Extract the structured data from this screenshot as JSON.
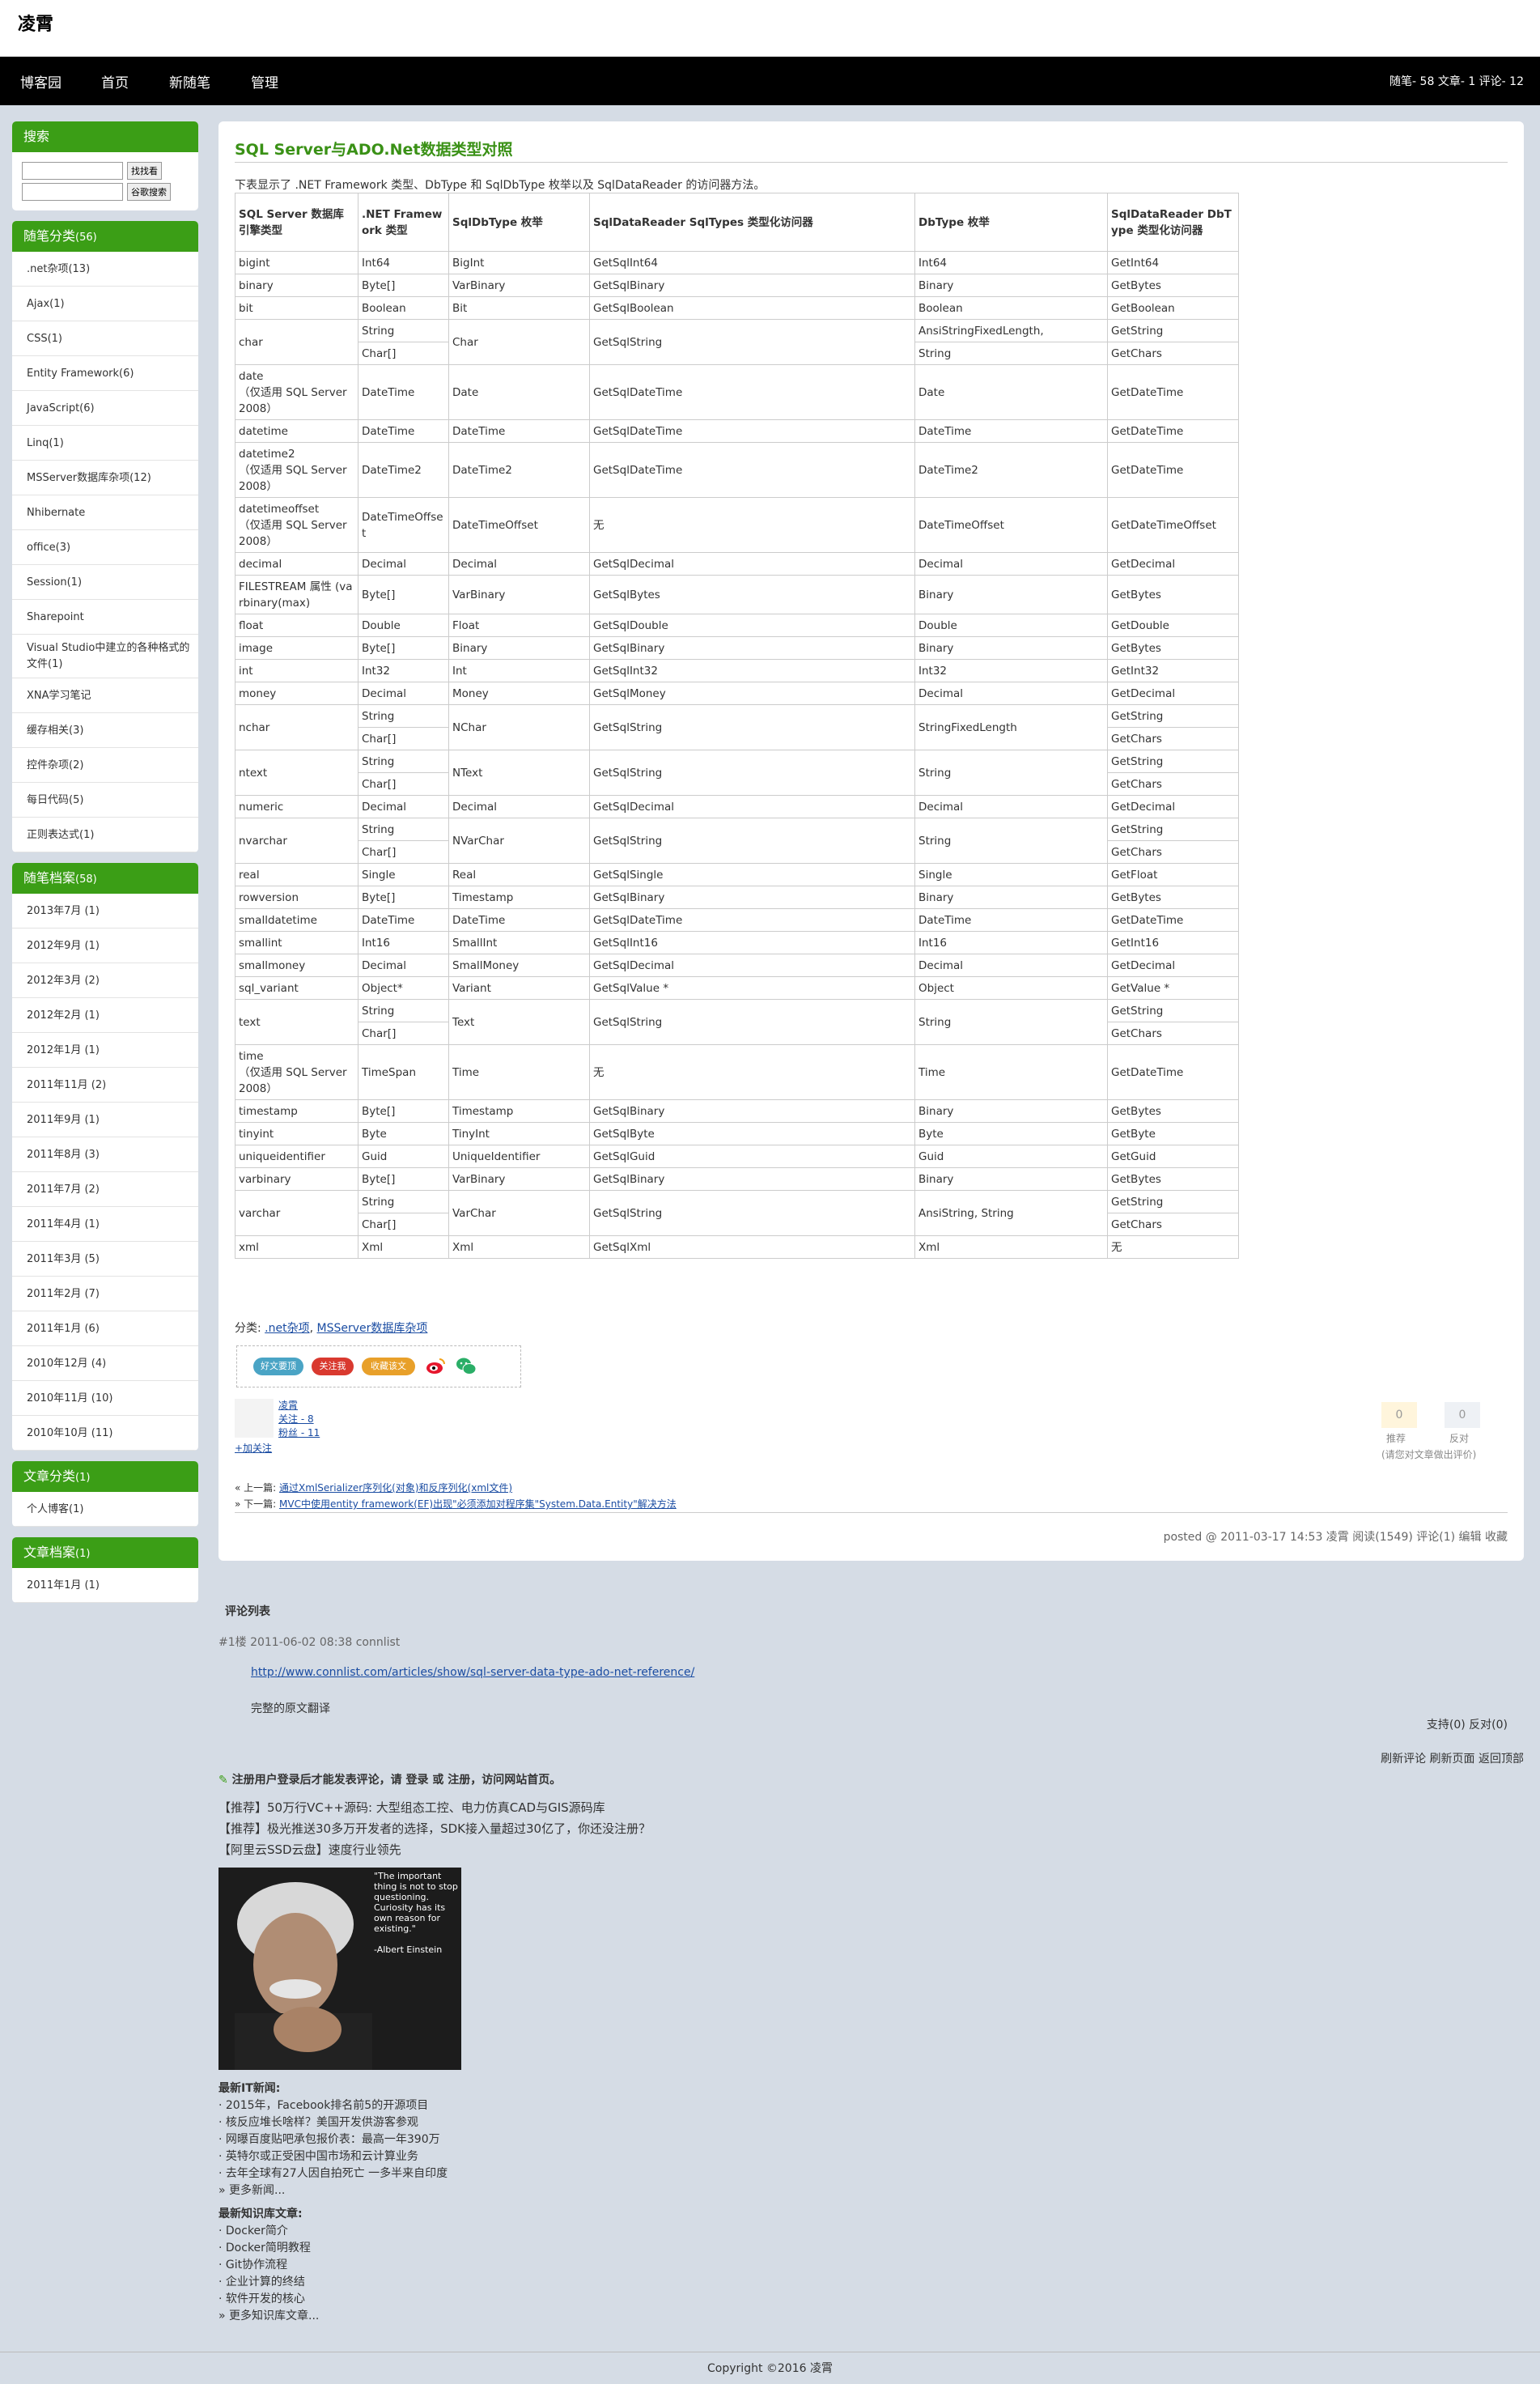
{
  "blog": {
    "title": "凌霄"
  },
  "nav": {
    "items": [
      "博客园",
      "首页",
      "新随笔",
      "管理"
    ],
    "stats": "随笔- 58  文章- 1  评论- 12"
  },
  "sidebar": {
    "search": {
      "title": "搜索",
      "btn1": "找找看",
      "btn2": "谷歌搜索"
    },
    "categories": {
      "title": "随笔分类",
      "count": "(56)",
      "items": [
        ".net杂项(13)",
        "Ajax(1)",
        "CSS(1)",
        "Entity Framework(6)",
        "JavaScript(6)",
        "Linq(1)",
        "MSServer数据库杂项(12)",
        "Nhibernate",
        "office(3)",
        "Session(1)",
        "Sharepoint",
        "Visual Studio中建立的各种格式的文件(1)",
        "XNA学习笔记",
        "缓存相关(3)",
        "控件杂项(2)",
        "每日代码(5)",
        "正则表达式(1)"
      ]
    },
    "archives": {
      "title": "随笔档案",
      "count": "(58)",
      "items": [
        "2013年7月 (1)",
        "2012年9月 (1)",
        "2012年3月 (2)",
        "2012年2月 (1)",
        "2012年1月 (1)",
        "2011年11月 (2)",
        "2011年9月 (1)",
        "2011年8月 (3)",
        "2011年7月 (2)",
        "2011年4月 (1)",
        "2011年3月 (5)",
        "2011年2月 (7)",
        "2011年1月 (6)",
        "2010年12月 (4)",
        "2010年11月 (10)",
        "2010年10月 (11)"
      ]
    },
    "article_cat": {
      "title": "文章分类",
      "count": "(1)",
      "items": [
        "个人博客(1)"
      ]
    },
    "article_arch": {
      "title": "文章档案",
      "count": "(1)",
      "items": [
        "2011年1月 (1)"
      ]
    }
  },
  "post": {
    "title": "SQL Server与ADO.Net数据类型对照",
    "intro": "下表显示了 .NET Framework 类型、DbType 和 SqlDbType 枚举以及 SqlDataReader 的访问器方法。",
    "headers": [
      "SQL Server 数据库引擎类型",
      ".NET Framework 类型",
      "SqlDbType 枚举",
      "SqlDataReader SqlTypes 类型化访问器",
      "DbType 枚举",
      "SqlDataReader DbType 类型化访问器"
    ],
    "rows": [
      [
        "bigint",
        "Int64",
        "BigInt",
        "GetSqlInt64",
        "Int64",
        "GetInt64"
      ],
      [
        "binary",
        "Byte[]",
        "VarBinary",
        "GetSqlBinary",
        "Binary",
        "GetBytes"
      ],
      [
        "bit",
        "Boolean",
        "Bit",
        "GetSqlBoolean",
        "Boolean",
        "GetBoolean"
      ],
      [
        "char",
        "String|Char[]",
        "Char",
        "GetSqlString",
        "AnsiStringFixedLength,|String",
        "GetString|GetChars"
      ],
      [
        "date\n（仅适用 SQL Server 2008）",
        "DateTime",
        "Date",
        "GetSqlDateTime",
        "Date",
        "GetDateTime"
      ],
      [
        "datetime",
        "DateTime",
        "DateTime",
        "GetSqlDateTime",
        "DateTime",
        "GetDateTime"
      ],
      [
        "datetime2\n（仅适用 SQL Server 2008）",
        "DateTime2",
        "DateTime2",
        "GetSqlDateTime",
        "DateTime2",
        "GetDateTime"
      ],
      [
        "datetimeoffset\n（仅适用 SQL Server 2008）",
        "DateTimeOffset",
        "DateTimeOffset",
        "无",
        "DateTimeOffset",
        "GetDateTimeOffset"
      ],
      [
        "decimal",
        "Decimal",
        "Decimal",
        "GetSqlDecimal",
        "Decimal",
        "GetDecimal"
      ],
      [
        "FILESTREAM 属性 (varbinary(max)",
        "Byte[]",
        "VarBinary",
        "GetSqlBytes",
        "Binary",
        "GetBytes"
      ],
      [
        "float",
        "Double",
        "Float",
        "GetSqlDouble",
        "Double",
        "GetDouble"
      ],
      [
        "image",
        "Byte[]",
        "Binary",
        "GetSqlBinary",
        "Binary",
        "GetBytes"
      ],
      [
        "int",
        "Int32",
        "Int",
        "GetSqlInt32",
        "Int32",
        "GetInt32"
      ],
      [
        "money",
        "Decimal",
        "Money",
        "GetSqlMoney",
        "Decimal",
        "GetDecimal"
      ],
      [
        "nchar",
        "String|Char[]",
        "NChar",
        "GetSqlString",
        "StringFixedLength",
        "GetString|GetChars"
      ],
      [
        "ntext",
        "String|Char[]",
        "NText",
        "GetSqlString",
        "String",
        "GetString|GetChars"
      ],
      [
        "numeric",
        "Decimal",
        "Decimal",
        "GetSqlDecimal",
        "Decimal",
        "GetDecimal"
      ],
      [
        "nvarchar",
        "String|Char[]",
        "NVarChar",
        "GetSqlString",
        "String",
        "GetString|GetChars"
      ],
      [
        "real",
        "Single",
        "Real",
        "GetSqlSingle",
        "Single",
        "GetFloat"
      ],
      [
        "rowversion",
        "Byte[]",
        "Timestamp",
        "GetSqlBinary",
        "Binary",
        "GetBytes"
      ],
      [
        "smalldatetime",
        "DateTime",
        "DateTime",
        "GetSqlDateTime",
        "DateTime",
        "GetDateTime"
      ],
      [
        "smallint",
        "Int16",
        "SmallInt",
        "GetSqlInt16",
        "Int16",
        "GetInt16"
      ],
      [
        "smallmoney",
        "Decimal",
        "SmallMoney",
        "GetSqlDecimal",
        "Decimal",
        "GetDecimal"
      ],
      [
        "sql_variant",
        "Object*",
        "Variant",
        "GetSqlValue *",
        "Object",
        "GetValue *"
      ],
      [
        "text",
        "String|Char[]",
        "Text",
        "GetSqlString",
        "String",
        "GetString|GetChars"
      ],
      [
        "time\n（仅适用 SQL Server 2008）",
        "TimeSpan",
        "Time",
        "无",
        "Time",
        "GetDateTime"
      ],
      [
        "timestamp",
        "Byte[]",
        "Timestamp",
        "GetSqlBinary",
        "Binary",
        "GetBytes"
      ],
      [
        "tinyint",
        "Byte",
        "TinyInt",
        "GetSqlByte",
        "Byte",
        "GetByte"
      ],
      [
        "uniqueidentifier",
        "Guid",
        "UniqueIdentifier",
        "GetSqlGuid",
        "Guid",
        "GetGuid"
      ],
      [
        "varbinary",
        "Byte[]",
        "VarBinary",
        "GetSqlBinary",
        "Binary",
        "GetBytes"
      ],
      [
        "varchar",
        "String|Char[]",
        "VarChar",
        "GetSqlString",
        "AnsiString, String",
        "GetString|GetChars"
      ],
      [
        "xml",
        "Xml",
        "Xml",
        "GetSqlXml",
        "Xml",
        "无"
      ]
    ],
    "category_label": "分类:",
    "categories": [
      ".net杂项",
      "MSServer数据库杂项"
    ],
    "share": {
      "btn1": "好文要顶",
      "btn2": "关注我",
      "btn3": "收藏该文"
    },
    "author": {
      "name": "凌霄",
      "follow": "关注 - 8",
      "fans": "粉丝 - 11",
      "add": "+加关注"
    },
    "vote": {
      "up": "0",
      "down": "0",
      "up_label": "推荐",
      "down_label": "反对",
      "tip": "(请您对文章做出评价)"
    },
    "prev": {
      "label": "« 上一篇:",
      "text": "通过XmlSerializer序列化(对象)和反序列化(xml文件)"
    },
    "next": {
      "label": "» 下一篇:",
      "text": "MVC中使用entity framework(EF)出现\"必须添加对程序集\"System.Data.Entity\"解决方法"
    },
    "footer": "posted @ 2011-03-17 14:53 凌霄 阅读(1549) 评论(1) 编辑 收藏"
  },
  "comments": {
    "title": "评论列表",
    "meta": "#1楼 2011-06-02 08:38 connlist",
    "link": "http://www.connlist.com/articles/show/sql-server-data-type-ado-net-reference/",
    "body": "完整的原文翻译",
    "vote": "支持(0)  反对(0)",
    "actions": "刷新评论  刷新页面  返回顶部"
  },
  "login_tip": "注册用户登录后才能发表评论，请 登录 或 注册，访问网站首页。",
  "ads": [
    "【推荐】50万行VC++源码: 大型组态工控、电力仿真CAD与GIS源码库",
    "【推荐】极光推送30多万开发者的选择，SDK接入量超过30亿了，你还没注册？",
    "【阿里云SSD云盘】速度行业领先"
  ],
  "quote": "\"The important thing is not to stop questioning. Curiosity has its own reason for existing.\"\n\n-Albert Einstein",
  "news": {
    "title": "最新IT新闻:",
    "items": [
      "· 2015年，Facebook排名前5的开源项目",
      "· 核反应堆长啥样？美国开发供游客参观",
      "· 网曝百度贴吧承包报价表：最高一年390万",
      "· 英特尔或正受困中国市场和云计算业务",
      "· 去年全球有27人因自拍死亡 一多半来自印度",
      "» 更多新闻..."
    ]
  },
  "kb": {
    "title": "最新知识库文章:",
    "items": [
      "· Docker简介",
      "· Docker简明教程",
      "· Git协作流程",
      "· 企业计算的终结",
      "· 软件开发的核心",
      "» 更多知识库文章..."
    ]
  },
  "footer": "Copyright ©2016 凌霄",
  "colors": {
    "accent": "#3b9e16",
    "nav_bg": "#000000",
    "page_bg": "#d5dce5"
  }
}
